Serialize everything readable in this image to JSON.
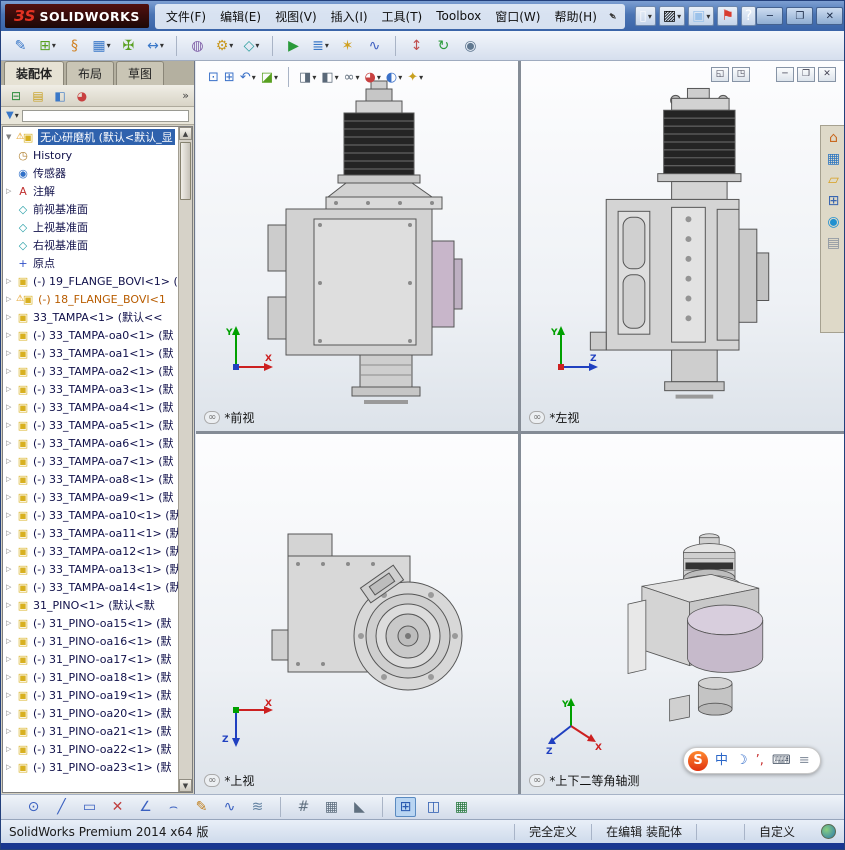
{
  "ui": {
    "caret": "▾",
    "scroll_up": "▲",
    "scroll_down": "▼",
    "chevron": "»",
    "warning": "⚠",
    "view_label_icon": "∞"
  },
  "titlebar": {
    "logo_mark": "ЗS",
    "logo_text": "SOLIDWORKS",
    "menus": [
      "文件(F)",
      "编辑(E)",
      "视图(V)",
      "插入(I)",
      "工具(T)",
      "Toolbox",
      "窗口(W)",
      "帮助(H)"
    ],
    "pin_glyph": "✒",
    "quick_icons": [
      {
        "name": "new-document-icon",
        "glyph": "▯",
        "color": "#f6f8fc",
        "caret": true
      },
      {
        "name": "open-document-icon",
        "glyph": "▨",
        "color": "#eshadow",
        "caret": true
      },
      {
        "name": "save-icon",
        "glyph": "▣",
        "color": "#9cc2ea",
        "caret": true
      },
      {
        "name": "toolbox-status-icon",
        "glyph": "⚑",
        "color": "#d83c30"
      },
      {
        "name": "help-icon",
        "glyph": "?",
        "color": "#ffffff"
      }
    ],
    "window_buttons": [
      {
        "name": "minimize-button",
        "glyph": "─"
      },
      {
        "name": "maximize-button",
        "glyph": "❐"
      },
      {
        "name": "close-button",
        "glyph": "✕"
      }
    ]
  },
  "main_toolbar": {
    "icons": [
      {
        "name": "edit-component-icon",
        "glyph": "✎",
        "color": "#3a78c8"
      },
      {
        "name": "insert-components-icon",
        "glyph": "⊞",
        "color": "#58a020",
        "caret": true
      },
      {
        "name": "mate-icon",
        "glyph": "§",
        "color": "#d08020"
      },
      {
        "name": "linear-component-pattern-icon",
        "glyph": "▦",
        "color": "#3a78c8",
        "caret": true
      },
      {
        "name": "smart-fasteners-icon",
        "glyph": "✠",
        "color": "#58a020"
      },
      {
        "name": "move-component-icon",
        "glyph": "↔",
        "color": "#3a78c8",
        "caret": true
      },
      {
        "sep": true
      },
      {
        "name": "show-hidden-components-icon",
        "glyph": "◍",
        "color": "#8060a8"
      },
      {
        "name": "assembly-features-icon",
        "glyph": "⚙",
        "color": "#c89820",
        "caret": true
      },
      {
        "name": "reference-geometry-icon",
        "glyph": "◇",
        "color": "#30a0a0",
        "caret": true
      },
      {
        "sep": true
      },
      {
        "name": "new-motion-study-icon",
        "glyph": "▶",
        "color": "#2a9a3a"
      },
      {
        "name": "bill-of-materials-icon",
        "glyph": "≣",
        "color": "#3a78c8",
        "caret": true
      },
      {
        "name": "exploded-view-icon",
        "glyph": "✶",
        "color": "#d0a020"
      },
      {
        "name": "explode-line-sketch-icon",
        "glyph": "∿",
        "color": "#4060c0"
      },
      {
        "sep": true
      },
      {
        "name": "instant3d-icon",
        "glyph": "↕",
        "color": "#c05050"
      },
      {
        "name": "update-assembly-icon",
        "glyph": "↻",
        "color": "#2a9a3a"
      },
      {
        "name": "take-snapshot-icon",
        "glyph": "◉",
        "color": "#607890"
      }
    ]
  },
  "left_panel": {
    "tabs": [
      {
        "label": "装配体",
        "active": true
      },
      {
        "label": "布局",
        "active": false
      },
      {
        "label": "草图",
        "active": false
      }
    ],
    "pane_tabs": [
      {
        "name": "featuremanager-tree-icon",
        "glyph": "⊟",
        "color": "#2a8a3a"
      },
      {
        "name": "propertymanager-icon",
        "glyph": "▤",
        "color": "#c8a020"
      },
      {
        "name": "configurationmanager-icon",
        "glyph": "◧",
        "color": "#3a78c8"
      },
      {
        "name": "displaymanager-icon",
        "glyph": "◕",
        "color": "#c84040"
      }
    ],
    "filter_glyph": "▼"
  },
  "tree": {
    "items": [
      {
        "arrow": "▼",
        "icon": "assembly-icon",
        "glyph": "▣",
        "color": "#d8b020",
        "label": "无心研磨机 (默认<默认_显",
        "selected": true,
        "warn": true
      },
      {
        "icon": "history-folder-icon",
        "glyph": "◷",
        "color": "#b08030",
        "label": "History"
      },
      {
        "icon": "sensors-icon",
        "glyph": "◉",
        "color": "#3070c8",
        "label": "传感器"
      },
      {
        "arrow": "▷",
        "icon": "annotations-icon",
        "glyph": "A",
        "color": "#c03030",
        "label": "注解"
      },
      {
        "icon": "plane-icon",
        "glyph": "◇",
        "color": "#2aa0a8",
        "label": "前视基准面"
      },
      {
        "icon": "plane-icon",
        "glyph": "◇",
        "color": "#2aa0a8",
        "label": "上视基准面"
      },
      {
        "icon": "plane-icon",
        "glyph": "◇",
        "color": "#2aa0a8",
        "label": "右视基准面"
      },
      {
        "icon": "origin-icon",
        "glyph": "+",
        "color": "#3050c8",
        "label": "原点"
      },
      {
        "arrow": "▷",
        "icon": "component-icon",
        "glyph": "▣",
        "color": "#d8b020",
        "label": "(-) 19_FLANGE_BOVI<1> (默"
      },
      {
        "arrow": "▷",
        "icon": "component-icon",
        "glyph": "▣",
        "color": "#d8b020",
        "label": "(-) 18_FLANGE_BOVI<1",
        "warn": true,
        "warn_text": true
      },
      {
        "arrow": "▷",
        "icon": "component-icon",
        "glyph": "▣",
        "color": "#d8b020",
        "label": "33_TAMPA<1> (默认<<"
      },
      {
        "arrow": "▷",
        "icon": "component-icon",
        "glyph": "▣",
        "color": "#d8b020",
        "label": "(-) 33_TAMPA-oa0<1> (默"
      },
      {
        "arrow": "▷",
        "icon": "component-icon",
        "glyph": "▣",
        "color": "#d8b020",
        "label": "(-) 33_TAMPA-oa1<1> (默"
      },
      {
        "arrow": "▷",
        "icon": "component-icon",
        "glyph": "▣",
        "color": "#d8b020",
        "label": "(-) 33_TAMPA-oa2<1> (默"
      },
      {
        "arrow": "▷",
        "icon": "component-icon",
        "glyph": "▣",
        "color": "#d8b020",
        "label": "(-) 33_TAMPA-oa3<1> (默"
      },
      {
        "arrow": "▷",
        "icon": "component-icon",
        "glyph": "▣",
        "color": "#d8b020",
        "label": "(-) 33_TAMPA-oa4<1> (默"
      },
      {
        "arrow": "▷",
        "icon": "component-icon",
        "glyph": "▣",
        "color": "#d8b020",
        "label": "(-) 33_TAMPA-oa5<1> (默"
      },
      {
        "arrow": "▷",
        "icon": "component-icon",
        "glyph": "▣",
        "color": "#d8b020",
        "label": "(-) 33_TAMPA-oa6<1> (默"
      },
      {
        "arrow": "▷",
        "icon": "component-icon",
        "glyph": "▣",
        "color": "#d8b020",
        "label": "(-) 33_TAMPA-oa7<1> (默"
      },
      {
        "arrow": "▷",
        "icon": "component-icon",
        "glyph": "▣",
        "color": "#d8b020",
        "label": "(-) 33_TAMPA-oa8<1> (默"
      },
      {
        "arrow": "▷",
        "icon": "component-icon",
        "glyph": "▣",
        "color": "#d8b020",
        "label": "(-) 33_TAMPA-oa9<1> (默"
      },
      {
        "arrow": "▷",
        "icon": "component-icon",
        "glyph": "▣",
        "color": "#d8b020",
        "label": "(-) 33_TAMPA-oa10<1> (默"
      },
      {
        "arrow": "▷",
        "icon": "component-icon",
        "glyph": "▣",
        "color": "#d8b020",
        "label": "(-) 33_TAMPA-oa11<1> (默"
      },
      {
        "arrow": "▷",
        "icon": "component-icon",
        "glyph": "▣",
        "color": "#d8b020",
        "label": "(-) 33_TAMPA-oa12<1> (默"
      },
      {
        "arrow": "▷",
        "icon": "component-icon",
        "glyph": "▣",
        "color": "#d8b020",
        "label": "(-) 33_TAMPA-oa13<1> (默"
      },
      {
        "arrow": "▷",
        "icon": "component-icon",
        "glyph": "▣",
        "color": "#d8b020",
        "label": "(-) 33_TAMPA-oa14<1> (默"
      },
      {
        "arrow": "▷",
        "icon": "component-icon",
        "glyph": "▣",
        "color": "#d8b020",
        "label": "31_PINO<1> (默认<默"
      },
      {
        "arrow": "▷",
        "icon": "component-icon",
        "glyph": "▣",
        "color": "#d8b020",
        "label": "(-) 31_PINO-oa15<1> (默"
      },
      {
        "arrow": "▷",
        "icon": "component-icon",
        "glyph": "▣",
        "color": "#d8b020",
        "label": "(-) 31_PINO-oa16<1> (默"
      },
      {
        "arrow": "▷",
        "icon": "component-icon",
        "glyph": "▣",
        "color": "#d8b020",
        "label": "(-) 31_PINO-oa17<1> (默"
      },
      {
        "arrow": "▷",
        "icon": "component-icon",
        "glyph": "▣",
        "color": "#d8b020",
        "label": "(-) 31_PINO-oa18<1> (默"
      },
      {
        "arrow": "▷",
        "icon": "component-icon",
        "glyph": "▣",
        "color": "#d8b020",
        "label": "(-) 31_PINO-oa19<1> (默"
      },
      {
        "arrow": "▷",
        "icon": "component-icon",
        "glyph": "▣",
        "color": "#d8b020",
        "label": "(-) 31_PINO-oa20<1> (默"
      },
      {
        "arrow": "▷",
        "icon": "component-icon",
        "glyph": "▣",
        "color": "#d8b020",
        "label": "(-) 31_PINO-oa21<1> (默"
      },
      {
        "arrow": "▷",
        "icon": "component-icon",
        "glyph": "▣",
        "color": "#d8b020",
        "label": "(-) 31_PINO-oa22<1> (默"
      },
      {
        "arrow": "▷",
        "icon": "component-icon",
        "glyph": "▣",
        "color": "#d8b020",
        "label": "(-) 31_PINO-oa23<1> (默"
      }
    ]
  },
  "view_toolbar": {
    "icons": [
      {
        "name": "zoom-fit-icon",
        "glyph": "⊡",
        "color": "#3a70c8"
      },
      {
        "name": "zoom-area-icon",
        "glyph": "⊞",
        "color": "#3a70c8"
      },
      {
        "name": "previous-view-icon",
        "glyph": "↶",
        "color": "#3a70c8",
        "caret": true
      },
      {
        "name": "section-view-icon",
        "glyph": "◪",
        "color": "#58a020",
        "caret": true
      },
      {
        "sep": true
      },
      {
        "name": "view-orientation-icon",
        "glyph": "◨",
        "color": "#5a6878",
        "caret": true
      },
      {
        "name": "display-style-icon",
        "glyph": "◧",
        "color": "#5a6878",
        "caret": true
      },
      {
        "name": "hide-show-items-icon",
        "glyph": "∞",
        "color": "#5a6878",
        "caret": true
      },
      {
        "name": "edit-appearance-icon",
        "glyph": "◕",
        "color": "#c84040",
        "caret": true
      },
      {
        "name": "apply-scene-icon",
        "glyph": "◐",
        "color": "#3a70c8",
        "caret": true
      },
      {
        "name": "view-settings-icon",
        "glyph": "✦",
        "color": "#c8a020",
        "caret": true
      }
    ]
  },
  "doc_controls": {
    "left": [
      {
        "name": "viewport-split-icon",
        "glyph": "◱"
      },
      {
        "name": "viewport-layout-icon",
        "glyph": "◳"
      }
    ],
    "right": [
      {
        "name": "doc-minimize-button",
        "glyph": "─"
      },
      {
        "name": "doc-restore-button",
        "glyph": "❐"
      },
      {
        "name": "doc-close-button",
        "glyph": "✕"
      }
    ]
  },
  "task_pane": {
    "icons": [
      {
        "name": "solidworks-resources-icon",
        "glyph": "⌂",
        "color": "#c86820"
      },
      {
        "name": "design-library-icon",
        "glyph": "▦",
        "color": "#2e76c0"
      },
      {
        "name": "file-explorer-icon",
        "glyph": "▱",
        "color": "#d8a020"
      },
      {
        "name": "view-palette-icon",
        "glyph": "⊞",
        "color": "#3a66b0"
      },
      {
        "name": "appearances-icon",
        "glyph": "◉",
        "color": "#2090d0"
      },
      {
        "name": "custom-properties-icon",
        "glyph": "▤",
        "color": "#88929e"
      }
    ]
  },
  "viewports": {
    "front": {
      "label": "*前视",
      "axis_up": "Y",
      "axis_right": "X"
    },
    "left": {
      "label": "*左视",
      "axis_up": "Y",
      "axis_right": "Z"
    },
    "top": {
      "label": "*上视",
      "axis_right": "X",
      "axis_down": "Z"
    },
    "iso": {
      "label": "*上下二等角轴测",
      "axis_up": "Y",
      "axis_right": "X",
      "axis_left": "Z"
    }
  },
  "bottom_toolbar": {
    "icons": [
      {
        "name": "point-tool-icon",
        "glyph": "⊙",
        "color": "#3a60c0"
      },
      {
        "name": "line-tool-icon",
        "glyph": "╱",
        "color": "#3a60c0"
      },
      {
        "name": "rectangle-tool-icon",
        "glyph": "▭",
        "color": "#3a60c0"
      },
      {
        "name": "erase-tool-icon",
        "glyph": "✕",
        "color": "#c04040"
      },
      {
        "name": "angle-tool-icon",
        "glyph": "∠",
        "color": "#3a60c0"
      },
      {
        "name": "arc-tool-icon",
        "glyph": "⌢",
        "color": "#3a60c0"
      },
      {
        "name": "pen-tool-icon",
        "glyph": "✎",
        "color": "#c08020"
      },
      {
        "name": "spline-tool-icon",
        "glyph": "∿",
        "color": "#3a60c0"
      },
      {
        "name": "hatch-tool-icon",
        "glyph": "≋",
        "color": "#6080a0"
      },
      {
        "sep": true
      },
      {
        "name": "grid-icon",
        "glyph": "#",
        "color": "#607080"
      },
      {
        "name": "pattern-icon",
        "glyph": "▦",
        "color": "#607080"
      },
      {
        "name": "angle-snap-icon",
        "glyph": "◣",
        "color": "#607080"
      },
      {
        "sep": true
      },
      {
        "name": "four-view-icon",
        "glyph": "⊞",
        "color": "#2a5ab0",
        "active": true
      },
      {
        "name": "two-view-icon",
        "glyph": "◫",
        "color": "#2a5ab0"
      },
      {
        "name": "table-icon",
        "glyph": "▦",
        "color": "#2a7a40"
      }
    ]
  },
  "statusbar": {
    "left": "SolidWorks Premium 2014 x64 版",
    "defined": "完全定义",
    "editing": "在编辑 装配体",
    "custom": "自定义"
  },
  "ime": {
    "logo": "S",
    "items": [
      {
        "name": "ime-language-icon",
        "glyph": "中",
        "color": "#2a66c8"
      },
      {
        "name": "ime-fullhalf-icon",
        "glyph": "☽",
        "color": "#2a66c8"
      },
      {
        "name": "ime-punct-icon",
        "glyph": "’,",
        "color": "#c83030"
      },
      {
        "name": "ime-keyboard-icon",
        "glyph": "⌨",
        "color": "#556070"
      },
      {
        "name": "ime-menu-icon",
        "glyph": "≡",
        "color": "#8892a0"
      }
    ]
  }
}
